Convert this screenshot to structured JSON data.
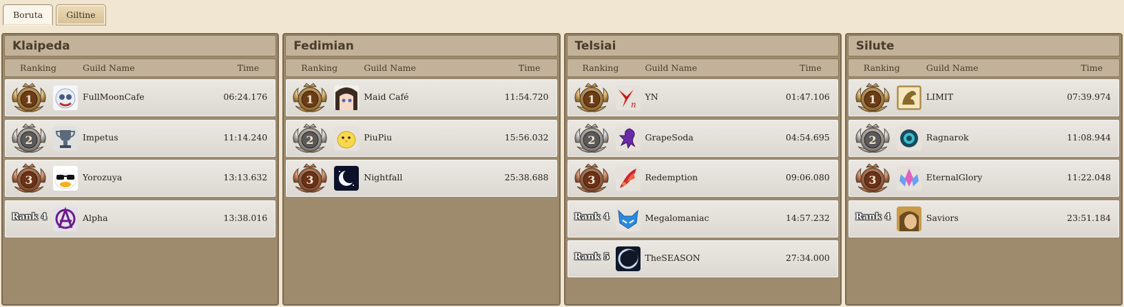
{
  "tabs": [
    {
      "label": "Boruta",
      "active": true
    },
    {
      "label": "Giltine",
      "active": false
    }
  ],
  "columns": {
    "ranking": "Ranking",
    "guild_name": "Guild Name",
    "time": "Time"
  },
  "rank_prefix": "Rank",
  "panels": [
    {
      "title": "Klaipeda",
      "rows": [
        {
          "rank": "1",
          "guild": "FullMoonCafe",
          "time": "06:24.176",
          "emblem": "snow-owl-icon"
        },
        {
          "rank": "2",
          "guild": "Impetus",
          "time": "11:14.240",
          "emblem": "trophy-icon"
        },
        {
          "rank": "3",
          "guild": "Yorozuya",
          "time": "13:13.632",
          "emblem": "duck-sunglasses-icon"
        },
        {
          "rank": "Rank 4",
          "guild": "Alpha",
          "time": "13:38.016",
          "emblem": "anarchy-icon"
        }
      ]
    },
    {
      "title": "Fedimian",
      "rows": [
        {
          "rank": "1",
          "guild": "Maid Café",
          "time": "11:54.720",
          "emblem": "anime-girl-icon"
        },
        {
          "rank": "2",
          "guild": "PiuPiu",
          "time": "15:56.032",
          "emblem": "chick-icon"
        },
        {
          "rank": "3",
          "guild": "Nightfall",
          "time": "25:38.688",
          "emblem": "crescent-moon-icon"
        }
      ]
    },
    {
      "title": "Telsiai",
      "rows": [
        {
          "rank": "1",
          "guild": "YN",
          "time": "01:47.106",
          "emblem": "yn-logo-icon"
        },
        {
          "rank": "2",
          "guild": "GrapeSoda",
          "time": "04:54.695",
          "emblem": "purple-dragon-icon"
        },
        {
          "rank": "3",
          "guild": "Redemption",
          "time": "09:06.080",
          "emblem": "phoenix-icon"
        },
        {
          "rank": "Rank 4",
          "guild": "Megalomaniac",
          "time": "14:57.232",
          "emblem": "blue-fox-icon"
        },
        {
          "rank": "Rank 5",
          "guild": "TheSEASON",
          "time": "27:34.000",
          "emblem": "dark-moon-icon"
        }
      ]
    },
    {
      "title": "Silute",
      "rows": [
        {
          "rank": "1",
          "guild": "LIMIT",
          "time": "07:39.974",
          "emblem": "gold-dragon-icon"
        },
        {
          "rank": "2",
          "guild": "Ragnarok",
          "time": "11:08.944",
          "emblem": "teal-gear-icon"
        },
        {
          "rank": "3",
          "guild": "EternalGlory",
          "time": "11:22.048",
          "emblem": "crystal-lotus-icon"
        },
        {
          "rank": "Rank 4",
          "guild": "Saviors",
          "time": "23:51.184",
          "emblem": "warrior-portrait-icon"
        }
      ]
    }
  ],
  "colors": {
    "gold_medal": "#b8893e",
    "silver_medal": "#9a9a9a",
    "bronze_medal": "#a0603a",
    "panel_bg": "#9e8b6e",
    "header_bg": "#c2b29a"
  }
}
